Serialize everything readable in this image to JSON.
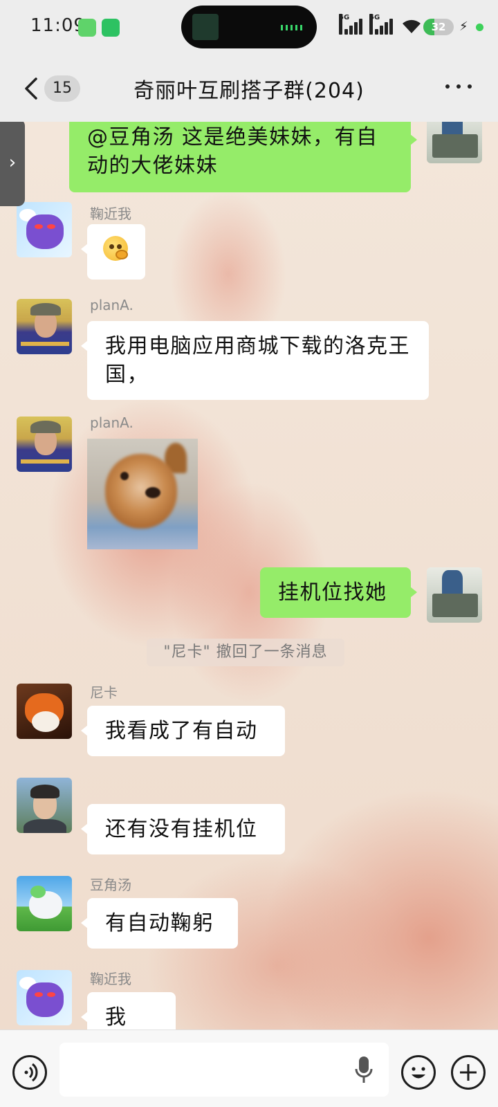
{
  "status_bar": {
    "time": "11:09",
    "signal_1": "5G",
    "signal_2": "5G",
    "battery": "32"
  },
  "header": {
    "unread_count": "15",
    "title": "奇丽叶互刷搭子群(204)"
  },
  "messages": [
    {
      "side": "right",
      "type": "text",
      "text": "@豆角汤  这是绝美妹妹，有自动的大佬妹妹"
    },
    {
      "side": "left",
      "type": "sticker",
      "sender": "鞠近我",
      "avatar": "gengar-avatar"
    },
    {
      "side": "left",
      "type": "text",
      "sender": "planA.",
      "text": "我用电脑应用商城下载的洛克王国，",
      "avatar": "planA-avatar"
    },
    {
      "side": "left",
      "type": "image",
      "sender": "planA.",
      "avatar": "planA-avatar"
    },
    {
      "side": "right",
      "type": "text",
      "text": "挂机位找她"
    },
    {
      "type": "system",
      "text": "\"尼卡\" 撤回了一条消息"
    },
    {
      "side": "left",
      "type": "text",
      "sender": "尼卡",
      "text": "我看成了有自动",
      "avatar": "fox-avatar"
    },
    {
      "side": "left",
      "type": "text",
      "sender": "",
      "text": "还有没有挂机位",
      "avatar": "boy-avatar"
    },
    {
      "side": "left",
      "type": "text",
      "sender": "豆角汤",
      "text": "有自动鞠躬",
      "avatar": "unicorn-avatar"
    },
    {
      "side": "left",
      "type": "text",
      "sender": "鞠近我",
      "text": "我 ios",
      "avatar": "gengar-avatar"
    }
  ],
  "bottom_bar": {
    "input_placeholder": "",
    "icons": [
      "voice-icon",
      "microphone-icon",
      "emoji-icon",
      "plus-icon"
    ]
  },
  "colors": {
    "my_bubble": "#95ec69",
    "other_bubble": "#ffffff",
    "bar_bg": "#ededed"
  }
}
